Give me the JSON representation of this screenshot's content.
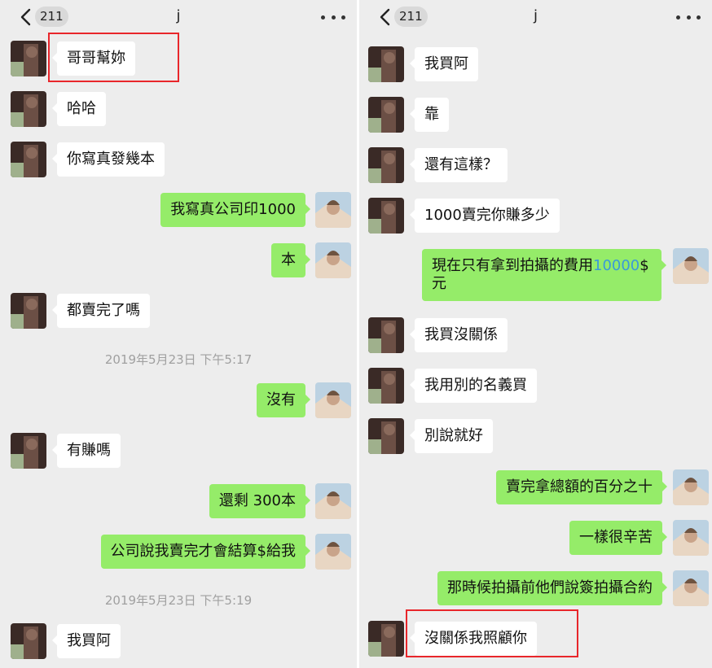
{
  "colors": {
    "background": "#ededed",
    "incoming_bubble": "#ffffff",
    "outgoing_bubble": "#95ec69",
    "timestamp_text": "#a0a0a0",
    "highlight_box": "#e8262b"
  },
  "left": {
    "header": {
      "back_icon": "chevron-left-icon",
      "unread_count": "211",
      "title": "j",
      "more_icon": "more-dots-icon"
    },
    "messages": {
      "m1": "哥哥幫妳",
      "m2": "哈哈",
      "m3": "你寫真發幾本",
      "m4": "我寫真公司印1000",
      "m5": "本",
      "m6": "都賣完了嗎",
      "ts1": "2019年5月23日 下午5:17",
      "m7": "沒有",
      "m8": "有賺嗎",
      "m9": "還剩 300本",
      "m10": "公司說我賣完才會結算$給我",
      "ts2": "2019年5月23日 下午5:19",
      "m11": "我買阿"
    }
  },
  "right": {
    "header": {
      "back_icon": "chevron-left-icon",
      "unread_count": "211",
      "title": "j",
      "more_icon": "more-dots-icon"
    },
    "messages": {
      "m1": "我買阿",
      "m2": "靠",
      "m3": "還有這樣？",
      "m4": "1000賣完你賺多少",
      "m5_part1": "現在只有拿到拍攝的費用",
      "m5_amount": "10000",
      "m5_part2": "$",
      "m5_line2": "元",
      "m6": "我買沒關係",
      "m7": "我用別的名義買",
      "m8": "別說就好",
      "m9": "賣完拿總額的百分之十",
      "m10": "一樣很辛苦",
      "m11": "那時候拍攝前他們說簽拍攝合約",
      "m12": "沒關係我照顧你"
    }
  }
}
